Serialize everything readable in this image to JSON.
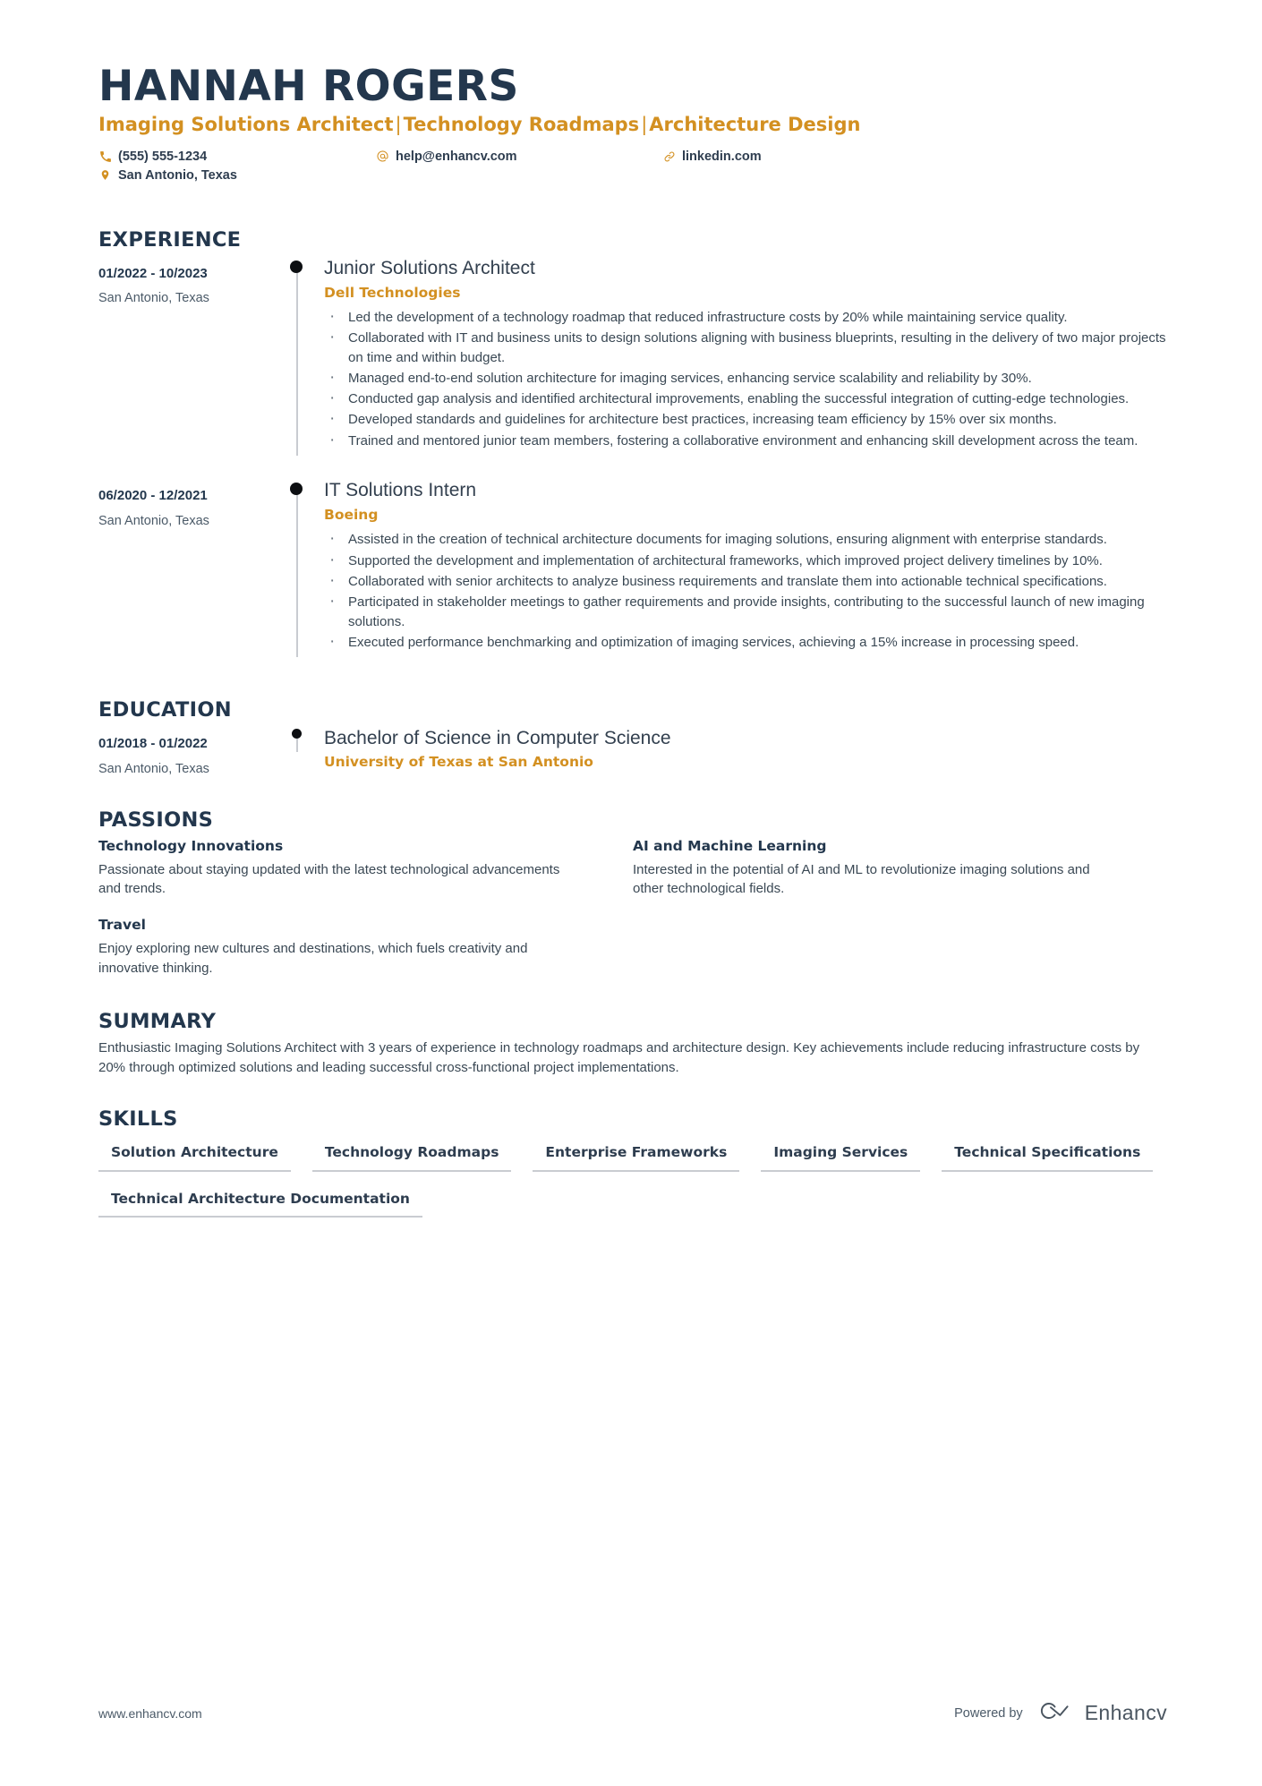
{
  "header": {
    "name": "HANNAH ROGERS",
    "headline_parts": [
      "Imaging Solutions Architect",
      "Technology Roadmaps",
      "Architecture Design"
    ],
    "headline_separator": "|",
    "contacts": {
      "phone": {
        "icon": "phone-icon",
        "value": "(555) 555-1234"
      },
      "email": {
        "icon": "at-icon",
        "value": "help@enhancv.com"
      },
      "linkedin": {
        "icon": "link-icon",
        "value": "linkedin.com"
      },
      "location": {
        "icon": "map-pin-icon",
        "value": "San Antonio, Texas"
      }
    }
  },
  "sections": {
    "experience_title": "EXPERIENCE",
    "education_title": "EDUCATION",
    "passions_title": "PASSIONS",
    "summary_title": "SUMMARY",
    "skills_title": "SKILLS"
  },
  "experience": [
    {
      "dates": "01/2022 - 10/2023",
      "location": "San Antonio, Texas",
      "title": "Junior Solutions Architect",
      "company": "Dell Technologies",
      "bullets": [
        "Led the development of a technology roadmap that reduced infrastructure costs by 20% while maintaining service quality.",
        "Collaborated with IT and business units to design solutions aligning with business blueprints, resulting in the delivery of two major projects on time and within budget.",
        "Managed end-to-end solution architecture for imaging services, enhancing service scalability and reliability by 30%.",
        "Conducted gap analysis and identified architectural improvements, enabling the successful integration of cutting-edge technologies.",
        "Developed standards and guidelines for architecture best practices, increasing team efficiency by 15% over six months.",
        "Trained and mentored junior team members, fostering a collaborative environment and enhancing skill development across the team."
      ]
    },
    {
      "dates": "06/2020 - 12/2021",
      "location": "San Antonio, Texas",
      "title": "IT Solutions Intern",
      "company": "Boeing",
      "bullets": [
        "Assisted in the creation of technical architecture documents for imaging solutions, ensuring alignment with enterprise standards.",
        "Supported the development and implementation of architectural frameworks, which improved project delivery timelines by 10%.",
        "Collaborated with senior architects to analyze business requirements and translate them into actionable technical specifications.",
        "Participated in stakeholder meetings to gather requirements and provide insights, contributing to the successful launch of new imaging solutions.",
        "Executed performance benchmarking and optimization of imaging services, achieving a 15% increase in processing speed."
      ]
    }
  ],
  "education": [
    {
      "dates": "01/2018 - 01/2022",
      "location": "San Antonio, Texas",
      "degree": "Bachelor of Science in Computer Science",
      "school": "University of Texas at San Antonio"
    }
  ],
  "passions": [
    {
      "title": "Technology Innovations",
      "description": "Passionate about staying updated with the latest technological advancements and trends."
    },
    {
      "title": "AI and Machine Learning",
      "description": "Interested in the potential of AI and ML to revolutionize imaging solutions and other technological fields."
    },
    {
      "title": "Travel",
      "description": "Enjoy exploring new cultures and destinations, which fuels creativity and innovative thinking."
    }
  ],
  "summary": {
    "text": "Enthusiastic Imaging Solutions Architect with 3 years of experience in technology roadmaps and architecture design. Key achievements include reducing infrastructure costs by 20% through optimized solutions and leading successful cross-functional project implementations."
  },
  "skills": [
    "Solution Architecture",
    "Technology Roadmaps",
    "Enterprise Frameworks",
    "Imaging Services",
    "Technical Specifications",
    "Technical Architecture Documentation"
  ],
  "footer": {
    "url": "www.enhancv.com",
    "powered_by": "Powered by",
    "brand_name": "Enhancv",
    "brand_logo_icon": "enhancv-logo-icon"
  },
  "colors": {
    "accent": "#d39021",
    "heading": "#23374d",
    "body": "#3a4854",
    "rule": "#c9ccd1"
  }
}
